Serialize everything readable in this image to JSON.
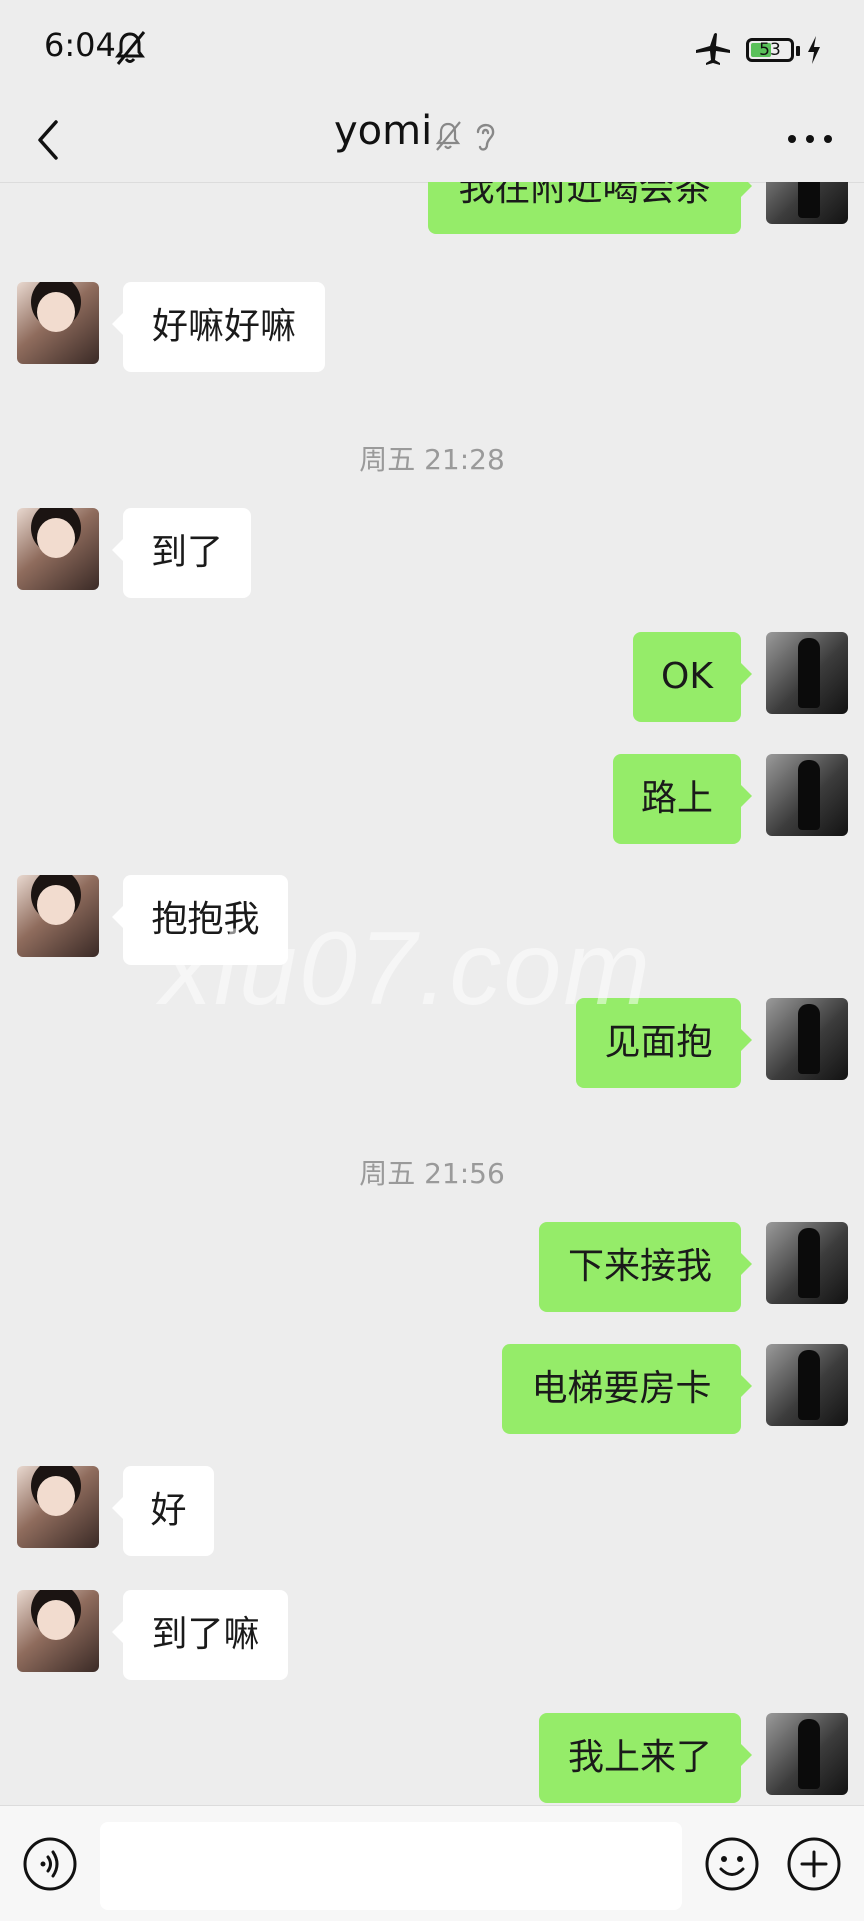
{
  "status_bar": {
    "time": "6:04",
    "battery_level": "53",
    "battery_percent": 53
  },
  "header": {
    "title": "yomi"
  },
  "messages": [
    {
      "side": "right",
      "text": "我在附近喝会茶"
    },
    {
      "side": "left",
      "text": "好嘛好嘛"
    },
    {
      "type": "time",
      "text": "周五 21:28"
    },
    {
      "side": "left",
      "text": "到了"
    },
    {
      "side": "right",
      "text": "OK"
    },
    {
      "side": "right",
      "text": "路上"
    },
    {
      "side": "left",
      "text": "抱抱我"
    },
    {
      "side": "right",
      "text": "见面抱"
    },
    {
      "type": "time",
      "text": "周五 21:56"
    },
    {
      "side": "right",
      "text": "下来接我"
    },
    {
      "side": "right",
      "text": "电梯要房卡"
    },
    {
      "side": "left",
      "text": "好"
    },
    {
      "side": "left",
      "text": "到了嘛"
    },
    {
      "side": "right",
      "text": "我上来了"
    }
  ],
  "watermark": "xiu07.com",
  "input": {
    "value": ""
  },
  "colors": {
    "background": "#ededed",
    "sent_bubble": "#95ec69",
    "received_bubble": "#ffffff",
    "timestamp": "#9a9a9a"
  }
}
